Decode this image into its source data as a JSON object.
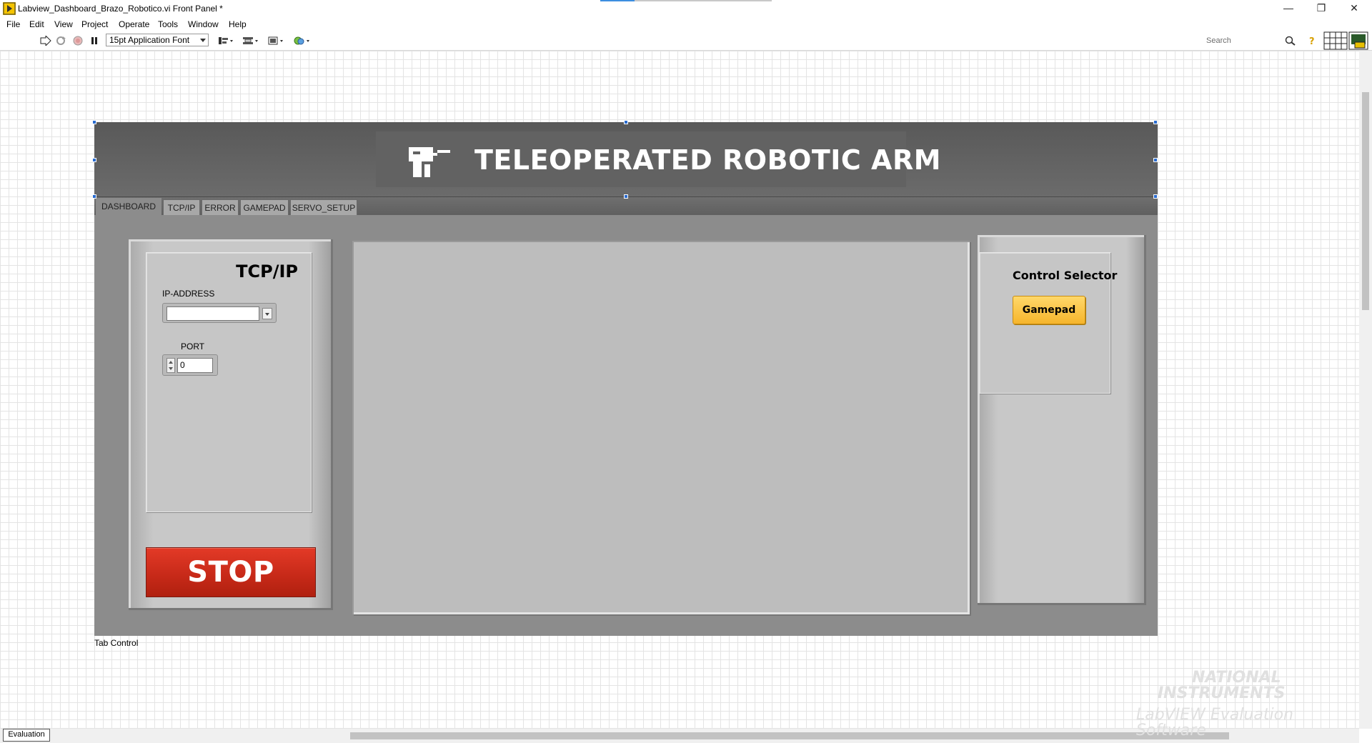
{
  "window": {
    "title": "Labview_Dashboard_Brazo_Robotico.vi Front Panel *",
    "controls": {
      "minimize": "—",
      "restore": "❐",
      "close": "✕"
    }
  },
  "menu": {
    "items": [
      "File",
      "Edit",
      "View",
      "Project",
      "Operate",
      "Tools",
      "Window",
      "Help"
    ]
  },
  "toolbar": {
    "font_select": "15pt Application Font",
    "search_placeholder": "Search",
    "icons": [
      "run-arrow-icon",
      "run-continuously-icon",
      "abort-execution-icon",
      "pause-icon",
      "align-objects-icon",
      "distribute-objects-icon",
      "resize-objects-icon",
      "reorder-icon",
      "search-icon",
      "help-icon",
      "vi-connector-pane-icon"
    ]
  },
  "front_panel": {
    "banner_title": "TELEOPERATED ROBOTIC ARM",
    "tabs": [
      "DASHBOARD",
      "TCP/IP",
      "ERROR",
      "GAMEPAD",
      "SERVO_SETUP"
    ],
    "active_tab": "DASHBOARD",
    "tcp_panel": {
      "title": "TCP/IP",
      "ip_label": "IP-ADDRESS",
      "ip_value": "",
      "port_label": "PORT",
      "port_value": "0"
    },
    "stop_label": "STOP",
    "control_selector": {
      "title": "Control Selector",
      "button_label": "Gamepad"
    },
    "tab_control_label": "Tab Control"
  },
  "status": {
    "evaluation_tab": "Evaluation"
  },
  "watermark": {
    "line1": "NATIONAL",
    "line2": "INSTRUMENTS",
    "line3": "LabVIEW Evaluation Software"
  },
  "colors": {
    "canvas_bg": "#ffffff",
    "grid": "#e4e4e4",
    "panel_gray": "#8c8c8c",
    "stop_red": "#c82a19",
    "gamepad_orange": "#f6b52c",
    "selection_blue": "#2a6cd0"
  }
}
